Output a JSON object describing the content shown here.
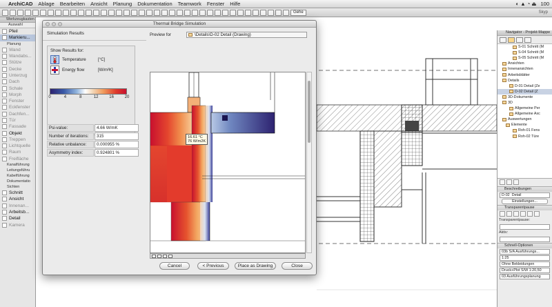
{
  "menubar": {
    "app_name": "ArchiCAD",
    "items": [
      "Ablage",
      "Bearbeiten",
      "Ansicht",
      "Planung",
      "Dokumentation",
      "Teamwork",
      "Fenster",
      "Hilfe"
    ],
    "right_text": "100"
  },
  "toolbar": {
    "layer_select": "Gehe",
    "right_label": "Skyp"
  },
  "toolbox": {
    "title": "Werkzeugkasten",
    "section": "Auswahl",
    "items": [
      {
        "label": "Pfeil",
        "state": "active"
      },
      {
        "label": "Markieru...",
        "state": "selected"
      },
      {
        "label": "Planung",
        "state": "cat"
      },
      {
        "label": "Wand",
        "state": ""
      },
      {
        "label": "Wandabs...",
        "state": ""
      },
      {
        "label": "Stütze",
        "state": ""
      },
      {
        "label": "Decke",
        "state": ""
      },
      {
        "label": "Unterzug",
        "state": ""
      },
      {
        "label": "Dach",
        "state": ""
      },
      {
        "label": "Schale",
        "state": ""
      },
      {
        "label": "Morph",
        "state": ""
      },
      {
        "label": "Fenster",
        "state": ""
      },
      {
        "label": "Eckfenster",
        "state": ""
      },
      {
        "label": "Dachfen...",
        "state": ""
      },
      {
        "label": "Tür",
        "state": ""
      },
      {
        "label": "Fassade",
        "state": ""
      },
      {
        "label": "Objekt",
        "state": "active"
      },
      {
        "label": "Treppen",
        "state": ""
      },
      {
        "label": "Lichtquelle",
        "state": ""
      },
      {
        "label": "Raum",
        "state": ""
      },
      {
        "label": "Freifläche",
        "state": ""
      },
      {
        "label": "Kanalführung",
        "state": "cat"
      },
      {
        "label": "Leitungsführu",
        "state": "cat"
      },
      {
        "label": "Kabelführung",
        "state": "cat"
      },
      {
        "label": "Dokumentatio",
        "state": "cat"
      },
      {
        "label": "Sichten",
        "state": "cat"
      },
      {
        "label": "Schnitt",
        "state": "active"
      },
      {
        "label": "Ansicht",
        "state": "active"
      },
      {
        "label": "Innenan...",
        "state": ""
      },
      {
        "label": "Arbeitsb...",
        "state": "active"
      },
      {
        "label": "Detail",
        "state": "active"
      },
      {
        "label": "Kamera",
        "state": ""
      }
    ]
  },
  "navigator": {
    "title": "Navigator - Projekt-Mappe",
    "tree": [
      {
        "label": "S-01 Schnitt (M",
        "indent": 4,
        "hl": false
      },
      {
        "label": "S-04 Schnitt (M",
        "indent": 4,
        "hl": false
      },
      {
        "label": "S-05 Schnitt (M",
        "indent": 4,
        "hl": false
      },
      {
        "label": "Ansichten",
        "indent": 1,
        "hl": false
      },
      {
        "label": "Innenansichten",
        "indent": 1,
        "hl": false
      },
      {
        "label": "Arbeitsblätter",
        "indent": 1,
        "hl": false
      },
      {
        "label": "Details",
        "indent": 1,
        "hl": false
      },
      {
        "label": "D-01 Detail (Ze",
        "indent": 3,
        "hl": false
      },
      {
        "label": "D-02 Detail (Z",
        "indent": 3,
        "hl": true
      },
      {
        "label": "3D-Dokumente",
        "indent": 1,
        "hl": false
      },
      {
        "label": "3D",
        "indent": 1,
        "hl": false
      },
      {
        "label": "Allgemeine Per",
        "indent": 3,
        "hl": false
      },
      {
        "label": "Allgemeine Axc",
        "indent": 3,
        "hl": false
      },
      {
        "label": "Auswertungen",
        "indent": 1,
        "hl": false
      },
      {
        "label": "Elemente",
        "indent": 2,
        "hl": false
      },
      {
        "label": "Roh-01 Fens",
        "indent": 4,
        "hl": false
      },
      {
        "label": "Roh-02 Türe",
        "indent": 4,
        "hl": false
      }
    ],
    "descriptions_label": "Beschreibungen",
    "detail_id": "D-02",
    "detail_name": "Detail",
    "settings_button": "Einstellungen...",
    "transparency_section": "Transparentpause",
    "transparency_label": "Transparentpause:",
    "active_label": "Aktiv:",
    "quick_options": "Schnell-Optionen",
    "quick_rows": [
      "03b S/A Ausführungs...",
      "1:25",
      "Ohne Bekleidungen",
      "Druck+Plot S/W 1:20,50",
      "03 Ausführungsplanung"
    ]
  },
  "dialog": {
    "title": "Thermal Bridge Simulation",
    "sim_results": "Simulation Results",
    "show_results_for": "Show Results for:",
    "options": [
      {
        "label": "Temperature",
        "unit": "[°C]",
        "icon": "thermometer-icon",
        "selected": true
      },
      {
        "label": "Energy flow",
        "unit": "[W/m²K]",
        "icon": "energy-flow-icon",
        "selected": false
      }
    ],
    "scale_ticks": [
      "0",
      "4",
      "8",
      "12",
      "16",
      "20"
    ],
    "stats": [
      {
        "label": "Psi-value:",
        "value": "4.66 W/mK"
      },
      {
        "label": "Number of iterations:",
        "value": "315"
      },
      {
        "label": "Relative unbalance:",
        "value": "0.000955 %"
      },
      {
        "label": "Asymmetry index:",
        "value": "0.924801 %"
      }
    ],
    "preview_for_label": "Preview for",
    "preview_path": "\\Details\\D-02 Detail (Drawing)",
    "tooltip_temp": "16.61 °C",
    "tooltip_flow": "76 W/m2K",
    "buttons": {
      "cancel": "Cancel",
      "previous": "< Previous",
      "place": "Place as Drawing",
      "close": "Close"
    }
  },
  "colors": {
    "hot": "#c8102e",
    "warm": "#f09a5c",
    "cold": "#2d2270",
    "selection": "#c8d2e3"
  }
}
